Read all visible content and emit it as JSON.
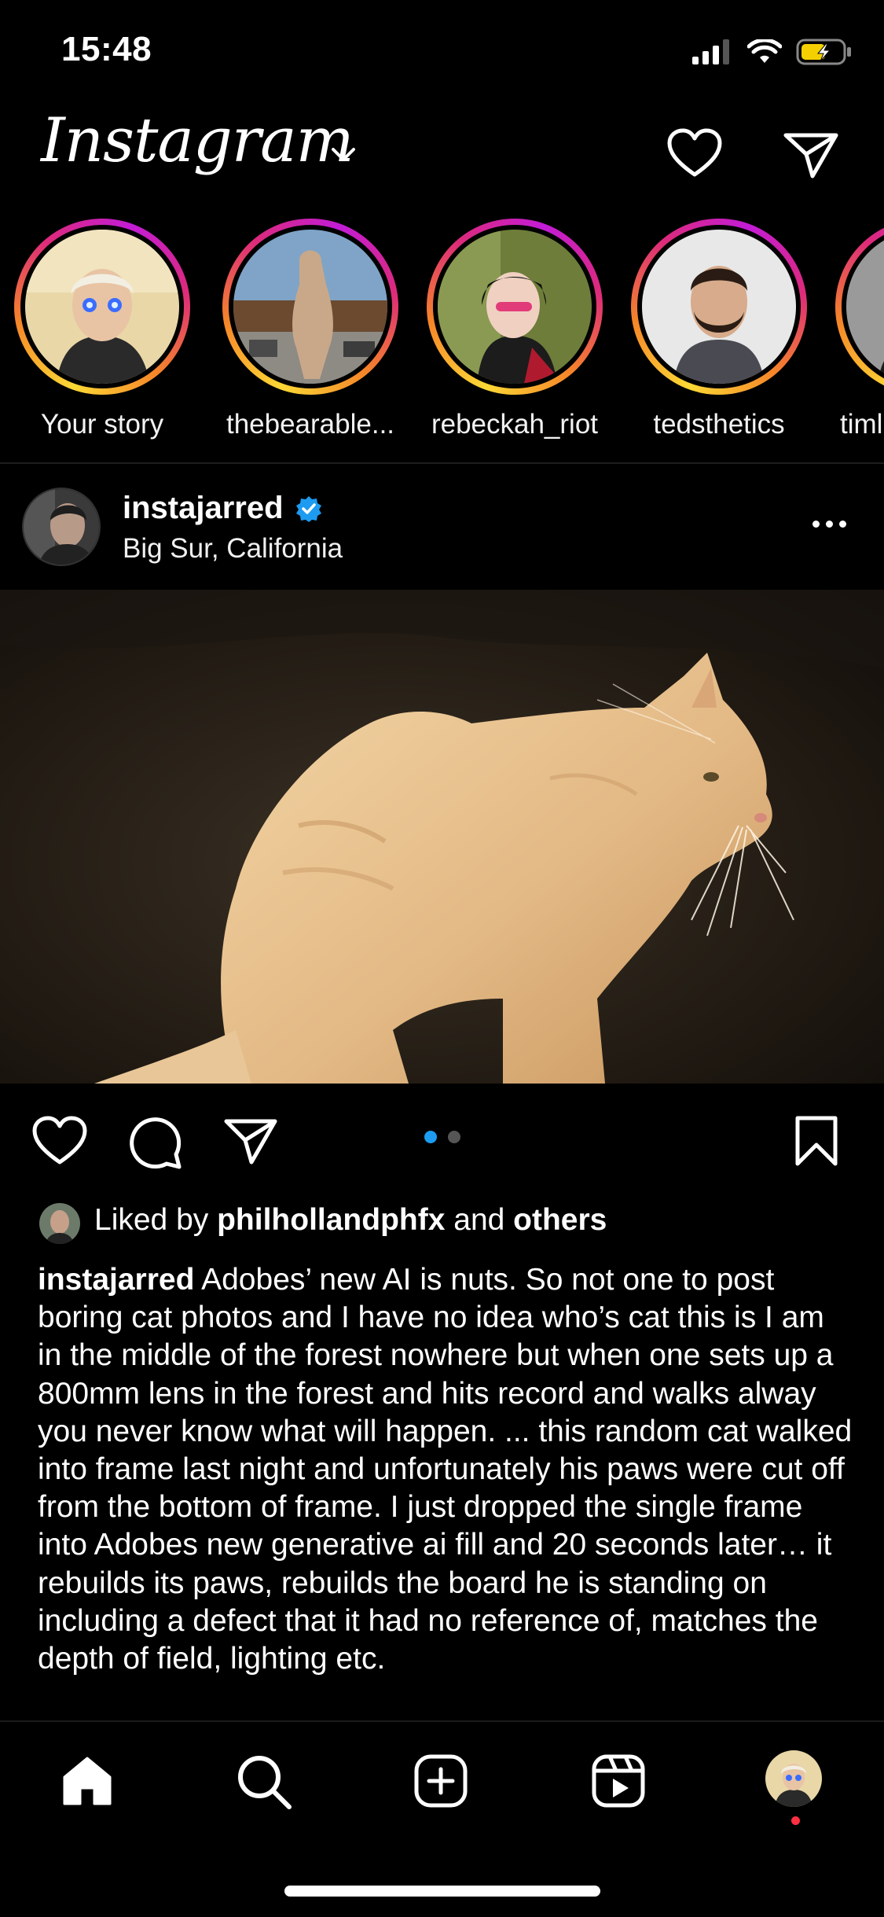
{
  "status_bar": {
    "time": "15:48"
  },
  "header": {
    "logo_text": "Instagram"
  },
  "stories": [
    {
      "label": "Your story"
    },
    {
      "label": "thebearable..."
    },
    {
      "label": "rebeckah_riot"
    },
    {
      "label": "tedsthetics"
    },
    {
      "label": "timl"
    }
  ],
  "post": {
    "username": "instajarred",
    "location": "Big Sur, California",
    "carousel": {
      "count": 2,
      "active_index": 0
    },
    "likes": {
      "prefix": "Liked by",
      "user": "philhollandphfx",
      "conjunction": "and",
      "others": "others"
    },
    "caption": {
      "username": "instajarred",
      "text": "Adobes’ new AI is nuts. So not one to post boring cat photos and I have no idea who’s cat this is I am in the middle of the forest nowhere but when one sets up a 800mm lens in the forest and hits record and walks alway you never know what will happen. ... this random cat walked into frame last night and unfortunately his paws were cut off from the bottom of frame.  I just dropped the single frame into Adobes new generative ai fill and 20 seconds later… it rebuilds its paws, rebuilds the board he is standing on including a defect that it had no reference of, matches the depth of field,  lighting etc."
    }
  },
  "colors": {
    "background": "#000000",
    "verified": "#1d9bf0",
    "notification": "#ff3040",
    "story_ring": [
      "#fdd835",
      "#f58529",
      "#dd2a7b",
      "#c21cd6"
    ]
  },
  "icons": {
    "header": [
      "chevron-down-icon",
      "heart-icon",
      "send-icon"
    ],
    "actions": [
      "heart-icon",
      "comment-icon",
      "share-icon",
      "bookmark-icon"
    ],
    "nav": [
      "home-icon",
      "search-icon",
      "create-icon",
      "reels-icon",
      "profile-avatar"
    ]
  }
}
